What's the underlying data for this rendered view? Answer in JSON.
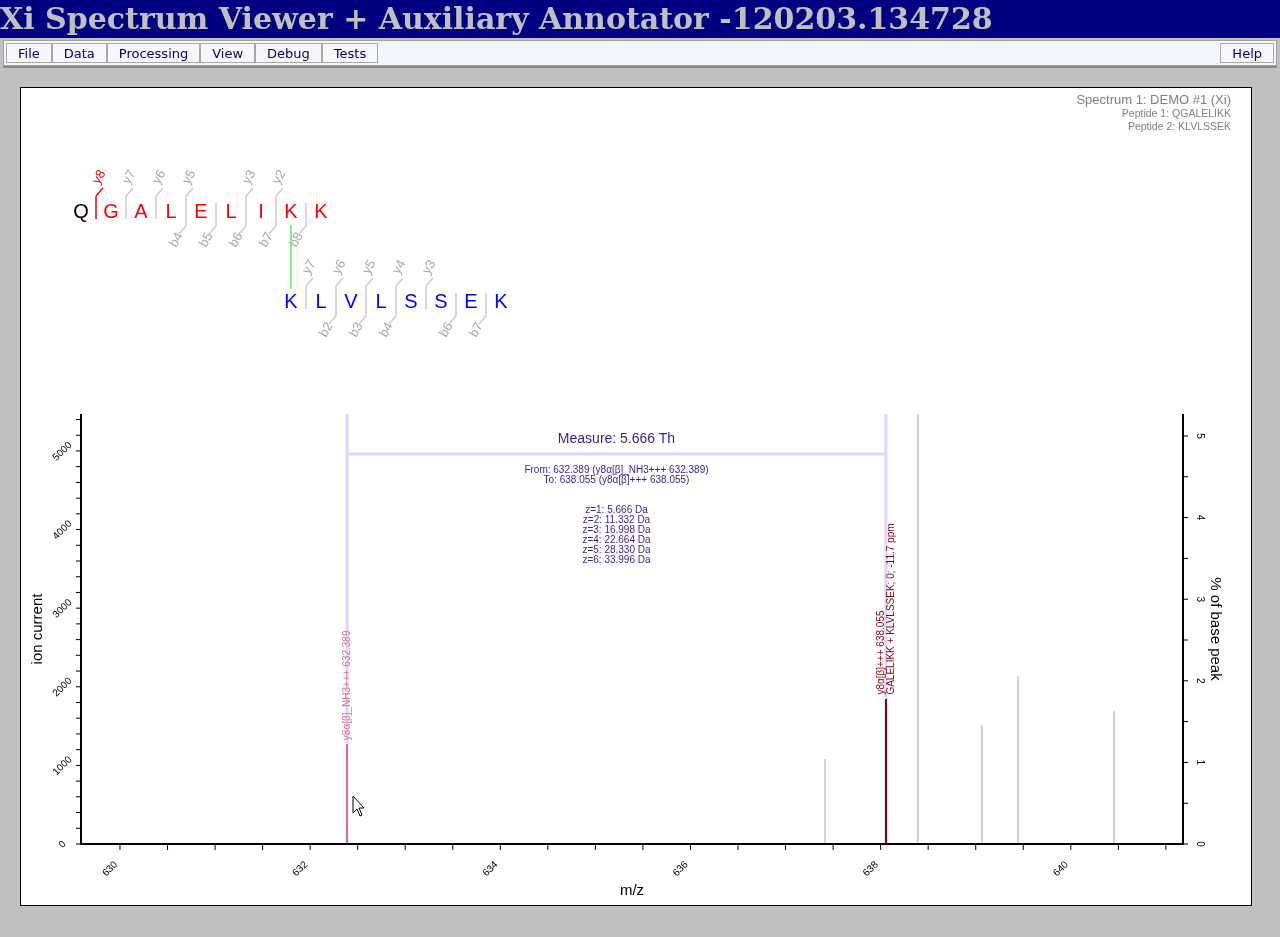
{
  "window": {
    "title": "Xi Spectrum Viewer + Auxiliary Annotator -120203.134728"
  },
  "menu_left": [
    "File",
    "Data",
    "Processing",
    "View",
    "Debug",
    "Tests"
  ],
  "menu_right": [
    "Help"
  ],
  "spectrum_info": {
    "title": "Spectrum 1: DEMO #1 (Xi)",
    "lines": [
      "Peptide 1: QGALELIKK",
      "Peptide 2: KLVLSSEK"
    ]
  },
  "peptides": [
    {
      "residues": [
        {
          "letter": "Q",
          "color": "#000000",
          "crosslinked": false
        },
        {
          "letter": "G",
          "color": "#ff0000",
          "crosslinked": false
        },
        {
          "letter": "A",
          "color": "#ff0000",
          "crosslinked": false
        },
        {
          "letter": "L",
          "color": "#ff0000",
          "crosslinked": false
        },
        {
          "letter": "E",
          "color": "#ff0000",
          "crosslinked": false
        },
        {
          "letter": "L",
          "color": "#ff0000",
          "crosslinked": false
        },
        {
          "letter": "I",
          "color": "#ff0000",
          "crosslinked": false
        },
        {
          "letter": "K",
          "color": "#ff0000",
          "crosslinked": true
        },
        {
          "letter": "K",
          "color": "#ff0000",
          "crosslinked": false
        }
      ],
      "gaps": [
        {
          "y": {
            "label": "y8",
            "matched": true
          }
        },
        {
          "y": {
            "label": "y7",
            "matched": false
          }
        },
        {
          "y": {
            "label": "y6",
            "matched": false
          }
        },
        {
          "y": {
            "label": "y5",
            "matched": false
          },
          "b": {
            "label": "b4",
            "matched": false
          }
        },
        {
          "b": {
            "label": "b5",
            "matched": false
          }
        },
        {
          "y": {
            "label": "y3",
            "matched": false
          },
          "b": {
            "label": "b6",
            "matched": false
          }
        },
        {
          "y": {
            "label": "y2",
            "matched": false
          },
          "b": {
            "label": "b7",
            "matched": false
          }
        },
        {
          "b": {
            "label": "b8",
            "matched": false
          }
        }
      ]
    },
    {
      "residues": [
        {
          "letter": "K",
          "color": "#0000ff",
          "crosslinked": true
        },
        {
          "letter": "L",
          "color": "#0000ff",
          "crosslinked": false
        },
        {
          "letter": "V",
          "color": "#0000ff",
          "crosslinked": false
        },
        {
          "letter": "L",
          "color": "#0000ff",
          "crosslinked": false
        },
        {
          "letter": "S",
          "color": "#0000ff",
          "crosslinked": false
        },
        {
          "letter": "S",
          "color": "#0000ff",
          "crosslinked": false
        },
        {
          "letter": "E",
          "color": "#0000ff",
          "crosslinked": false
        },
        {
          "letter": "K",
          "color": "#0000ff",
          "crosslinked": false
        }
      ],
      "gaps": [
        {
          "y": {
            "label": "y7",
            "matched": false
          }
        },
        {
          "y": {
            "label": "y6",
            "matched": false
          },
          "b": {
            "label": "b2",
            "matched": false
          }
        },
        {
          "y": {
            "label": "y5",
            "matched": false
          },
          "b": {
            "label": "b3",
            "matched": false
          }
        },
        {
          "y": {
            "label": "y4",
            "matched": false
          },
          "b": {
            "label": "b4",
            "matched": false
          }
        },
        {
          "y": {
            "label": "y3",
            "matched": false
          }
        },
        {
          "b": {
            "label": "b6",
            "matched": false
          }
        },
        {
          "b": {
            "label": "b7",
            "matched": false
          }
        }
      ]
    }
  ],
  "spectrum": {
    "chart_data": {
      "type": "bar",
      "xlabel": "m/z",
      "ylabel": "ion current",
      "x": [
        632.389,
        637.41,
        638.055,
        638.39,
        639.07,
        639.44,
        640.45
      ],
      "series": [
        {
          "values": [
            1270,
            1080,
            1850,
            5470,
            1510,
            2140,
            1690
          ]
        }
      ],
      "xlim": [
        629.59,
        641.18
      ],
      "ylim": [
        0,
        5470
      ],
      "xticks": [
        630,
        632,
        634,
        636,
        638,
        640
      ],
      "yticks": [
        0,
        1000,
        2000,
        3000,
        4000,
        5000
      ]
    },
    "peaks": [
      {
        "color": "#d87093",
        "labels": [
          "y8α[β]_NH3+++ 632.389"
        ]
      },
      {
        "color": "#d3d3d3"
      },
      {
        "color": "#8b0000",
        "labels": [
          "y8α[β]+++ 638.055",
          "GALELIKK + KLVLSSEK; 0; -11.7 ppm"
        ]
      },
      {
        "color": "#d3d3d3"
      },
      {
        "color": "#d3d3d3"
      },
      {
        "color": "#d3d3d3"
      },
      {
        "color": "#d3d3d3"
      }
    ],
    "right_axis": {
      "label": "% of base peak",
      "ticks": [
        "0",
        "1",
        "2",
        "3",
        "4",
        "5"
      ]
    },
    "measure": {
      "title": "Measure: 5.666 Th",
      "lines": [
        "From: 632.389 (y8α[β]_NH3+++ 632.389)",
        "To: 638.055 (y8α[β]+++ 638.055)"
      ],
      "charges": [
        "z=1: 5.666 Da",
        "z=2: 11.332 Da",
        "z=3: 16.998 Da",
        "z=4: 22.664 Da",
        "z=5: 28.330 Da",
        "z=6: 33.996 Da"
      ]
    }
  }
}
